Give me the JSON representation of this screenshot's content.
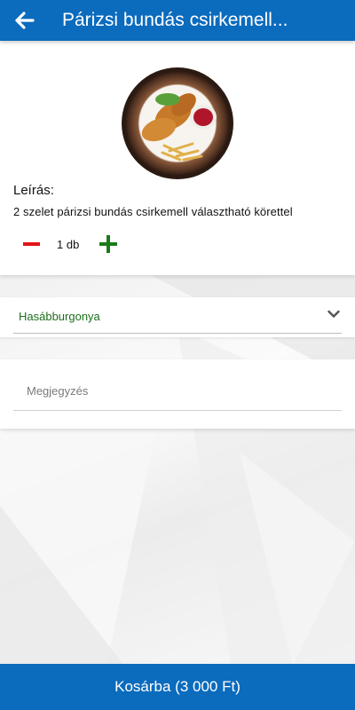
{
  "header": {
    "title": "Párizsi bundás csirkemell...",
    "back_icon": "arrow-left-icon",
    "color": "#0b6bbd"
  },
  "product": {
    "image_icon": "food-plate-image",
    "description_label": "Leírás:",
    "description": "2 szelet párizsi bundás csirkemell választható körettel"
  },
  "quantity": {
    "value_text": "1 db",
    "minus_icon": "minus-icon",
    "plus_icon": "plus-icon",
    "minus_color": "#e01515",
    "plus_color": "#1a7a1a"
  },
  "side_select": {
    "selected": "Hasábburgonya",
    "chevron_icon": "chevron-down-icon"
  },
  "note": {
    "placeholder": "Megjegyzés",
    "value": ""
  },
  "footer": {
    "cart_label": "Kosárba (3 000 Ft)"
  }
}
